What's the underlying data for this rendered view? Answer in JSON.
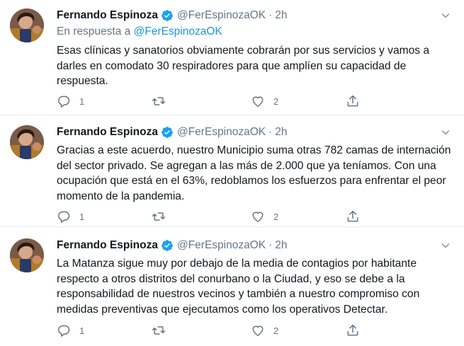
{
  "colors": {
    "text": "#14171a",
    "secondary": "#657786",
    "link": "#1b95e0",
    "verified": "#1da1f2",
    "divider": "#e6ecf0"
  },
  "tweets": [
    {
      "author_name": "Fernando Espinoza",
      "handle": "@FerEspinozaOK",
      "separator": "·",
      "time": "2h",
      "reply_prefix": "En respuesta a",
      "reply_handle": "@FerEspinozaOK",
      "text": "Esas clínicas y sanatorios obviamente cobrarán por sus servicios y vamos a darles en comodato 30 respiradores para que amplíen su capacidad de respuesta.",
      "reply_count": "1",
      "retweet_count": "",
      "like_count": "2",
      "icons": {
        "reply": "reply-icon",
        "retweet": "retweet-icon",
        "like": "heart-icon",
        "share": "share-icon",
        "verified": "verified-badge-icon",
        "menu": "chevron-down-icon"
      }
    },
    {
      "author_name": "Fernando Espinoza",
      "handle": "@FerEspinozaOK",
      "separator": "·",
      "time": "2h",
      "text": "Gracias a este acuerdo, nuestro Municipio suma otras 782 camas de internación del sector privado. Se agregan a las más de 2.000 que ya teníamos. Con una ocupación que está en el 63%, redoblamos los esfuerzos para enfrentar el peor momento de la pandemia.",
      "reply_count": "1",
      "retweet_count": "",
      "like_count": "2"
    },
    {
      "author_name": "Fernando Espinoza",
      "handle": "@FerEspinozaOK",
      "separator": "·",
      "time": "2h",
      "text": "La Matanza sigue muy por debajo de la media de contagios por habitante respecto a otros distritos del conurbano o la Ciudad, y eso se debe a la responsabilidad de nuestros vecinos y también a nuestro compromiso con medidas preventivas que ejecutamos como los operativos Detectar.",
      "reply_count": "1",
      "retweet_count": "",
      "like_count": "2"
    }
  ]
}
